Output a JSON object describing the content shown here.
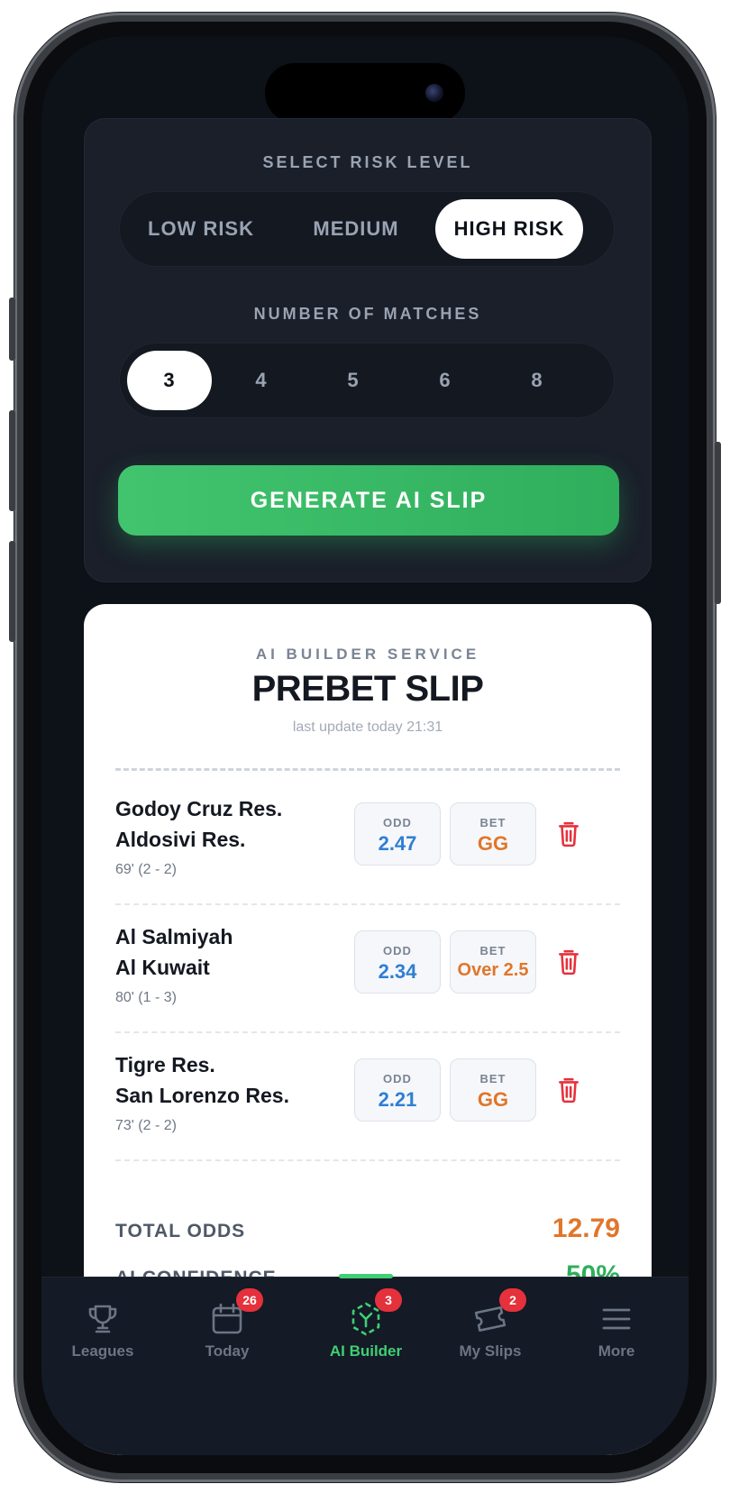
{
  "risk": {
    "title": "SELECT RISK LEVEL",
    "options": [
      "LOW RISK",
      "MEDIUM",
      "HIGH RISK"
    ],
    "selected": "HIGH RISK"
  },
  "matches_count": {
    "title": "NUMBER OF MATCHES",
    "options": [
      "3",
      "4",
      "5",
      "6",
      "8"
    ],
    "selected": "3"
  },
  "generate_label": "GENERATE AI SLIP",
  "slip": {
    "eyebrow": "AI BUILDER SERVICE",
    "title": "PREBET SLIP",
    "last_update": "last update today 21:31",
    "odd_label": "ODD",
    "bet_label": "BET",
    "matches": [
      {
        "home": "Godoy Cruz Res.",
        "away": "Aldosivi Res.",
        "status": "69' (2 - 2)",
        "odd": "2.47",
        "bet": "GG"
      },
      {
        "home": "Al Salmiyah",
        "away": "Al Kuwait",
        "status": "80' (1 - 3)",
        "odd": "2.34",
        "bet": "Over 2.5"
      },
      {
        "home": "Tigre Res.",
        "away": "San Lorenzo Res.",
        "status": "73' (2 - 2)",
        "odd": "2.21",
        "bet": "GG"
      }
    ],
    "total_odds_label": "TOTAL ODDS",
    "total_odds": "12.79",
    "confidence_label": "AI CONFIDENCE",
    "confidence": "50%"
  },
  "tabbar": {
    "active": "AI Builder",
    "items": [
      {
        "label": "Leagues",
        "icon": "trophy-icon",
        "badge": ""
      },
      {
        "label": "Today",
        "icon": "calendar-icon",
        "badge": "26"
      },
      {
        "label": "AI Builder",
        "icon": "ai-builder-icon",
        "badge": "3"
      },
      {
        "label": "My Slips",
        "icon": "ticket-icon",
        "badge": "2"
      },
      {
        "label": "More",
        "icon": "menu-icon",
        "badge": ""
      }
    ]
  },
  "colors": {
    "accent_green": "#3fcf74",
    "odd_blue": "#2f7fd2",
    "bet_orange": "#e0762a",
    "badge_red": "#e5313c",
    "trash_red": "#e5313c"
  }
}
